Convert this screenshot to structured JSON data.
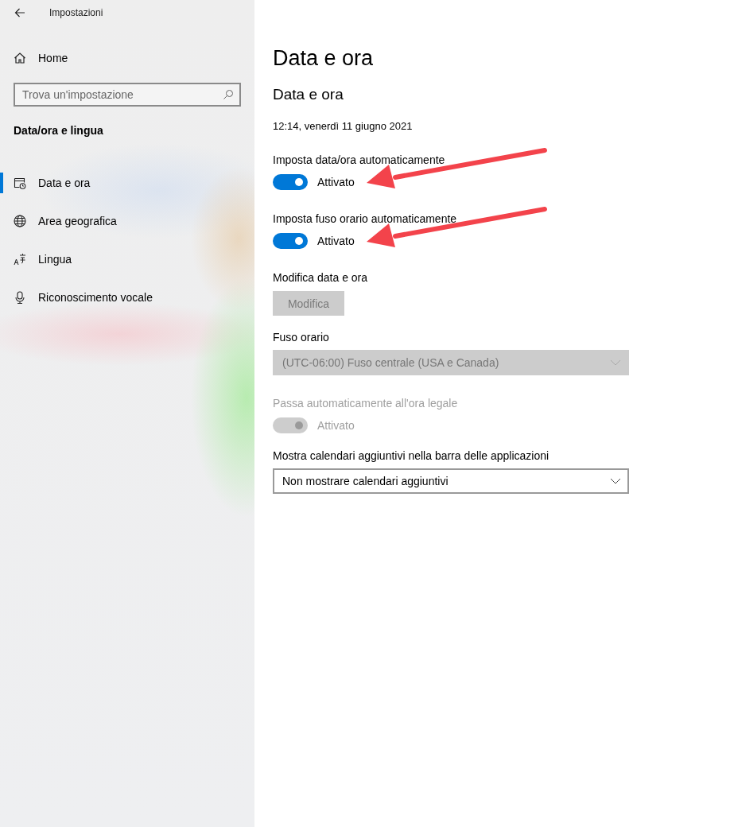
{
  "window": {
    "title": "Impostazioni"
  },
  "sidebar": {
    "home": "Home",
    "search": {
      "placeholder": "Trova un'impostazione"
    },
    "section": "Data/ora e lingua",
    "items": [
      {
        "label": "Data e ora",
        "selected": true
      },
      {
        "label": "Area geografica",
        "selected": false
      },
      {
        "label": "Lingua",
        "selected": false
      },
      {
        "label": "Riconoscimento vocale",
        "selected": false
      }
    ]
  },
  "page": {
    "title": "Data e ora",
    "subtitle": "Data e ora",
    "settings": [
      {
        "kind": "text",
        "text": "12:14, venerdì 11 giugno 2021"
      },
      {
        "kind": "toggle",
        "label": "Imposta data/ora automaticamente",
        "on": true,
        "disabled": false,
        "state": "Attivato",
        "highlighted": true
      },
      {
        "kind": "toggle",
        "label": "Imposta fuso orario automaticamente",
        "on": true,
        "disabled": false,
        "state": "Attivato",
        "highlighted": true
      },
      {
        "kind": "button",
        "label": "Modifica data e ora",
        "button": "Modifica",
        "disabled": true
      },
      {
        "kind": "dropdown",
        "label": "Fuso orario",
        "value": "(UTC-06:00) Fuso centrale (USA e Canada)",
        "disabled": true
      },
      {
        "kind": "toggle",
        "label": "Passa automaticamente all'ora legale",
        "on": true,
        "disabled": true,
        "state": "Attivato",
        "highlighted": false
      },
      {
        "kind": "dropdown",
        "label": "Mostra calendari aggiuntivi nella barra delle applicazioni",
        "value": "Non mostrare calendari aggiuntivi",
        "disabled": false
      }
    ]
  }
}
